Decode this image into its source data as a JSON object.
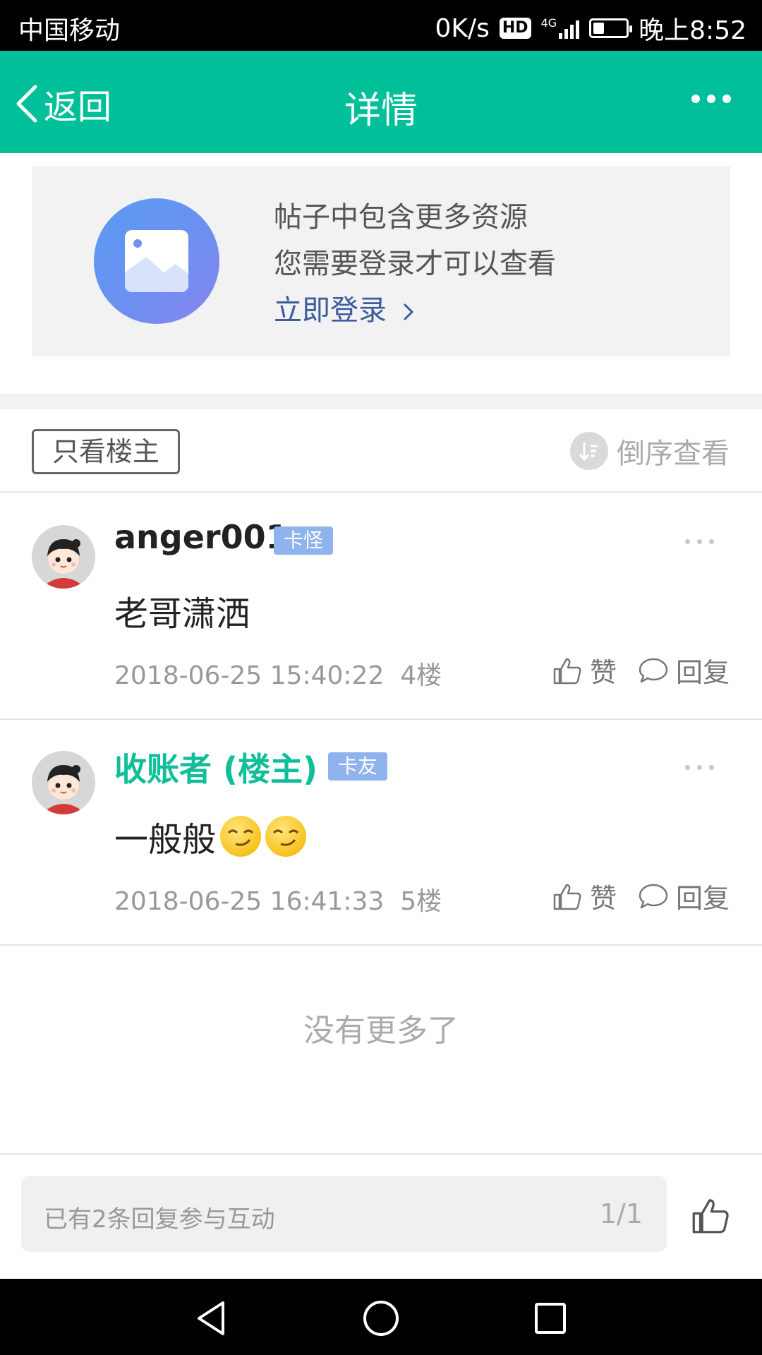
{
  "status_bar": {
    "carrier": "中国移动",
    "net_speed": "0K/s",
    "hd_badge": "HD",
    "network": "4G",
    "time": "晚上8:52",
    "battery_level": 0.35
  },
  "nav": {
    "back_label": "返回",
    "title": "详情"
  },
  "banner": {
    "line1": "帖子中包含更多资源",
    "line2": "您需要登录才可以查看",
    "login_link": "立即登录"
  },
  "filter": {
    "only_op_label": "只看楼主",
    "reverse_label": "倒序查看"
  },
  "posts": [
    {
      "username": "anger001",
      "badge": "卡怪",
      "content": "老哥潇洒",
      "time": "2018-06-25 15:40:22",
      "floor": "4楼",
      "like_label": "赞",
      "reply_label": "回复"
    },
    {
      "username": "收账者 (楼主)",
      "badge": "卡友",
      "content": "一般般",
      "time": "2018-06-25 16:41:33",
      "floor": "5楼",
      "like_label": "赞",
      "reply_label": "回复"
    }
  ],
  "footer": {
    "no_more": "没有更多了"
  },
  "bottom_bar": {
    "placeholder": "已有2条回复参与互动",
    "page_indicator": "1/1"
  },
  "colors": {
    "accent": "#00bf99",
    "badge": "#8fb3ec",
    "link": "#3c5c9c"
  }
}
